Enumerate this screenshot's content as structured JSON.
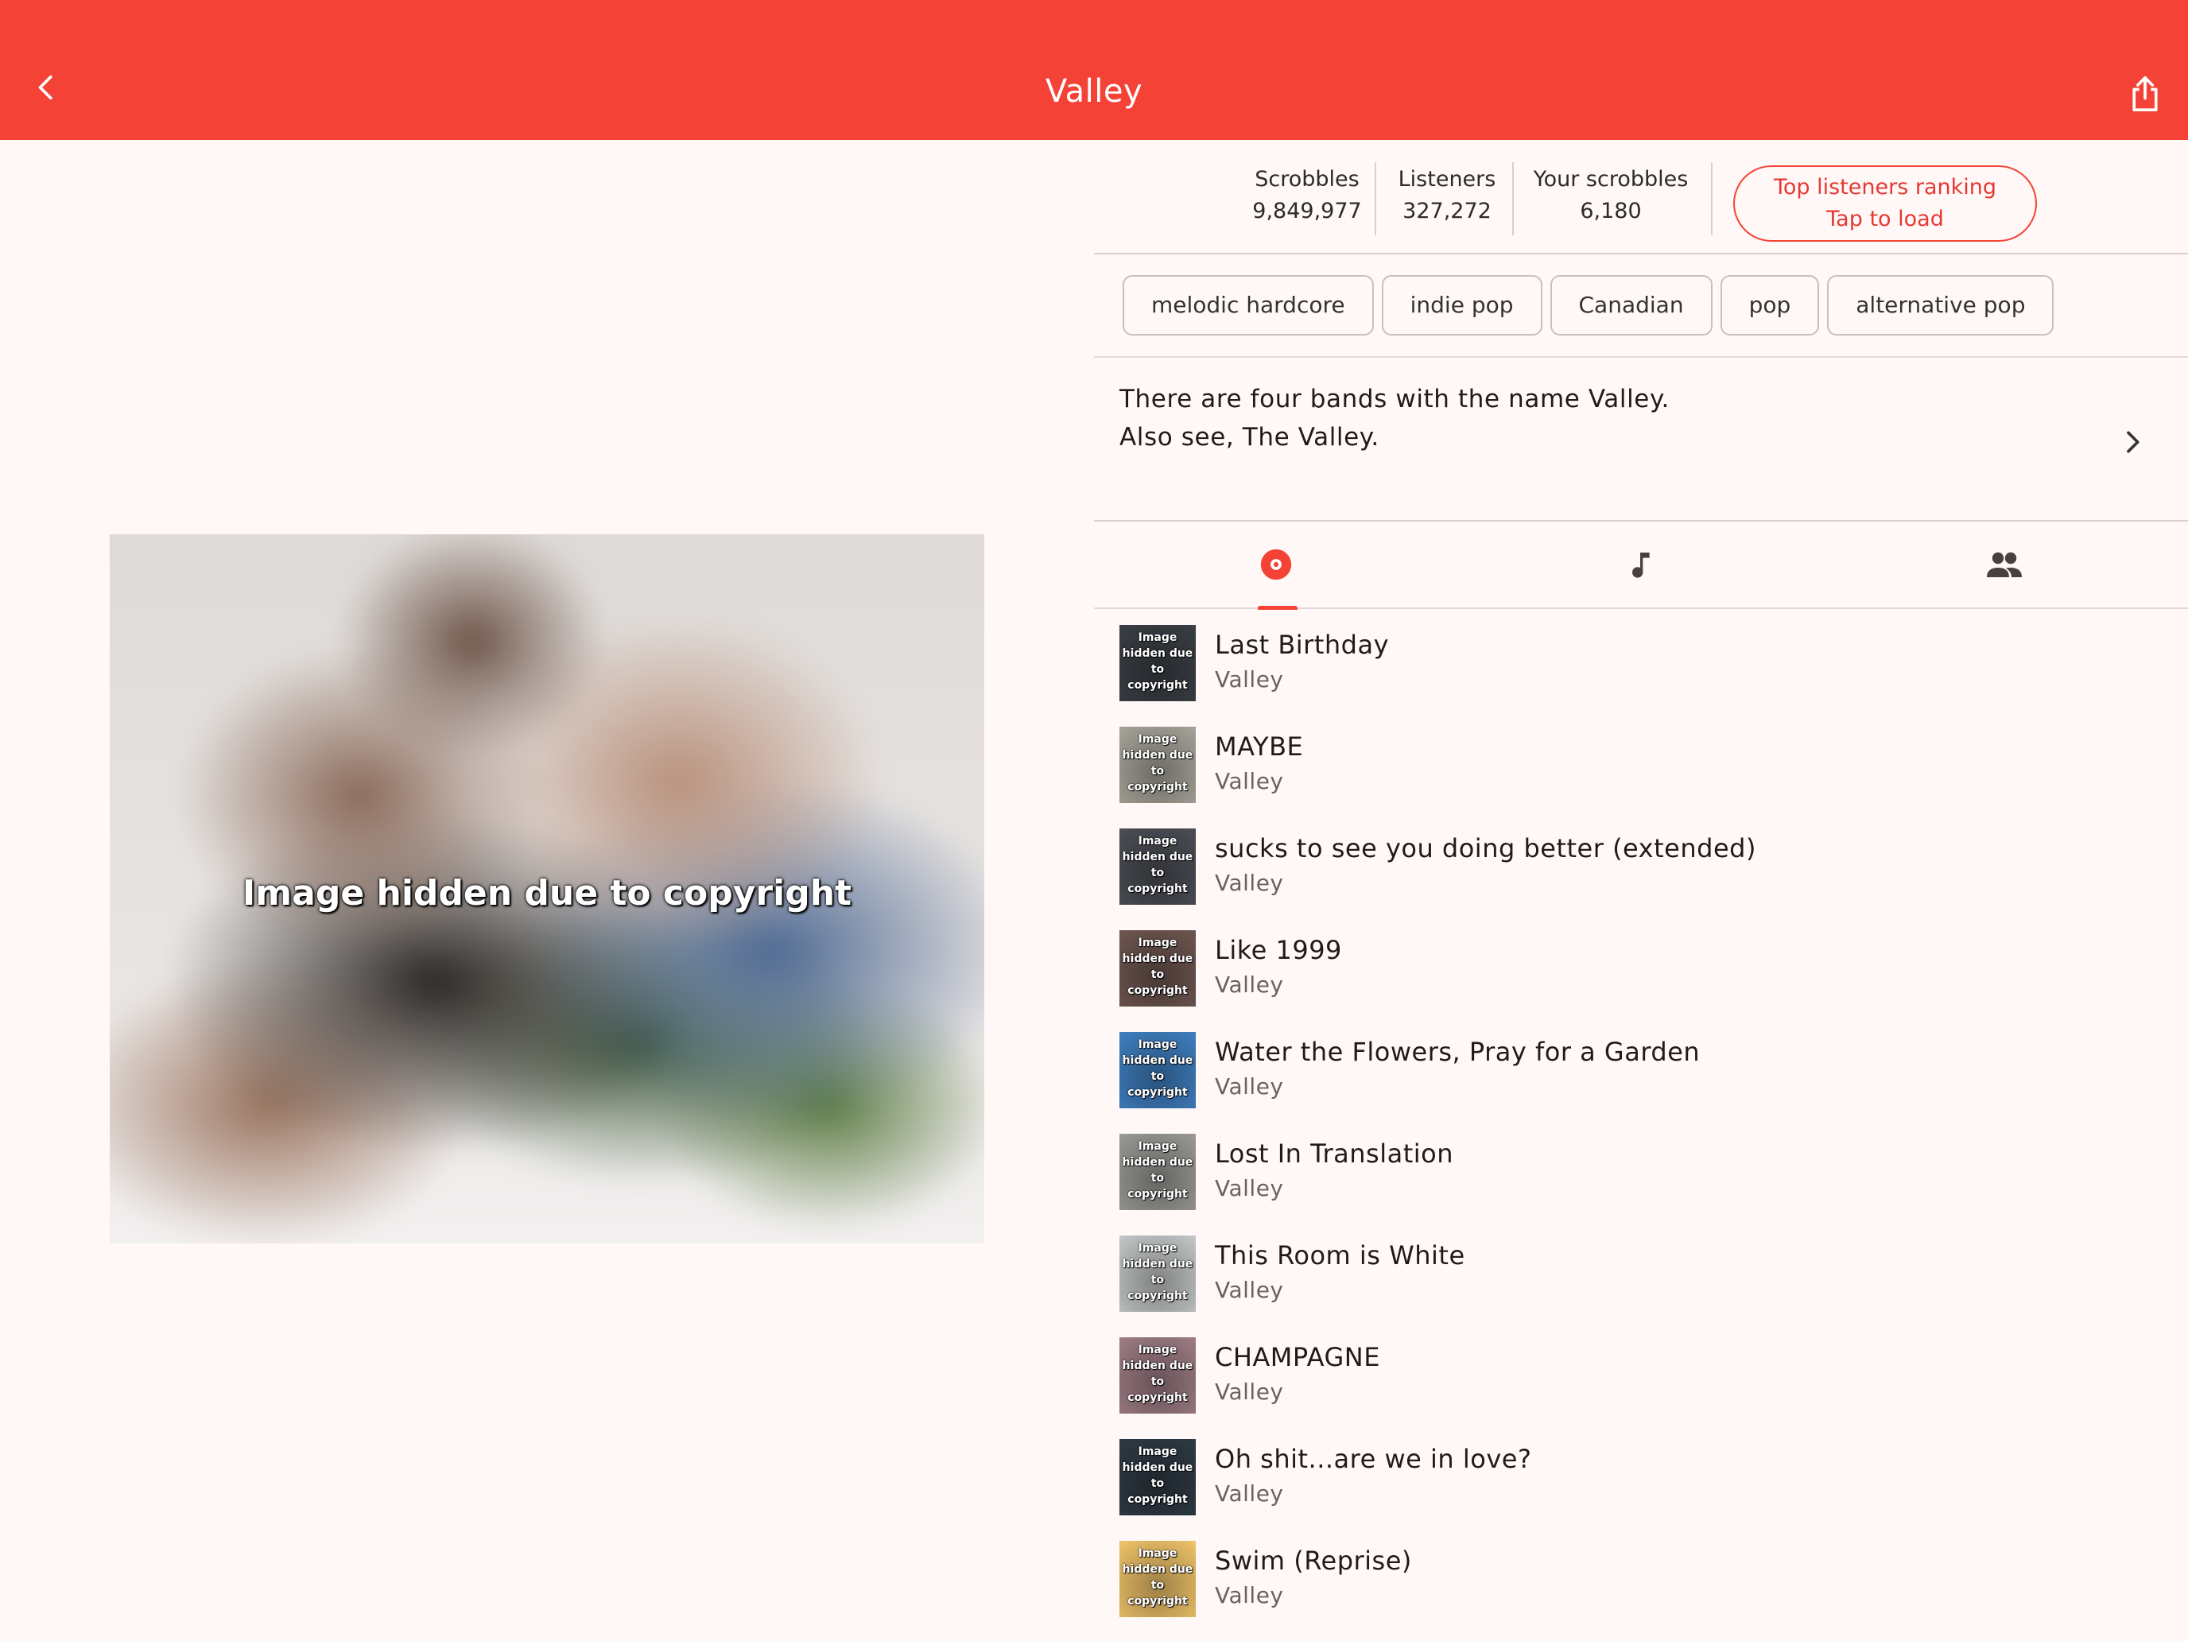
{
  "appbar": {
    "title": "Valley",
    "accent": "#f44336"
  },
  "image": {
    "caption": "Image hidden due to copyright"
  },
  "stats": [
    {
      "label": "Scrobbles",
      "value": "9,849,977"
    },
    {
      "label": "Listeners",
      "value": "327,272"
    },
    {
      "label": "Your scrobbles",
      "value": "6,180"
    }
  ],
  "ranking": {
    "line1": "Top listeners ranking",
    "line2": "Tap to load"
  },
  "tags": [
    "melodic hardcore",
    "indie pop",
    "Canadian",
    "pop",
    "alternative pop"
  ],
  "bio": {
    "line1": "There are four bands with the name Valley.",
    "line2": "Also see, The Valley."
  },
  "tabs": {
    "items": [
      "album-icon",
      "track-icon",
      "similar-artists-icon"
    ],
    "selected": 0
  },
  "thumb_text": "Image hidden due to copyright",
  "albums": [
    {
      "title": "Last Birthday",
      "artist": "Valley",
      "bg": "#3a3f45"
    },
    {
      "title": "MAYBE",
      "artist": "Valley",
      "bg": "#a7a59a"
    },
    {
      "title": "sucks to see you doing better (extended)",
      "artist": "Valley",
      "bg": "#4b4e55"
    },
    {
      "title": "Like 1999",
      "artist": "Valley",
      "bg": "#6e5650"
    },
    {
      "title": "Water the Flowers, Pray for a Garden",
      "artist": "Valley",
      "bg": "#3f7fc0"
    },
    {
      "title": "Lost In Translation",
      "artist": "Valley",
      "bg": "#9a9a96"
    },
    {
      "title": "This Room is White",
      "artist": "Valley",
      "bg": "#c5c8c8"
    },
    {
      "title": "CHAMPAGNE",
      "artist": "Valley",
      "bg": "#9e7d85"
    },
    {
      "title": "Oh shit...are we in love?",
      "artist": "Valley",
      "bg": "#2f3a44"
    },
    {
      "title": "Swim (Reprise)",
      "artist": "Valley",
      "bg": "#f0c46a"
    }
  ]
}
